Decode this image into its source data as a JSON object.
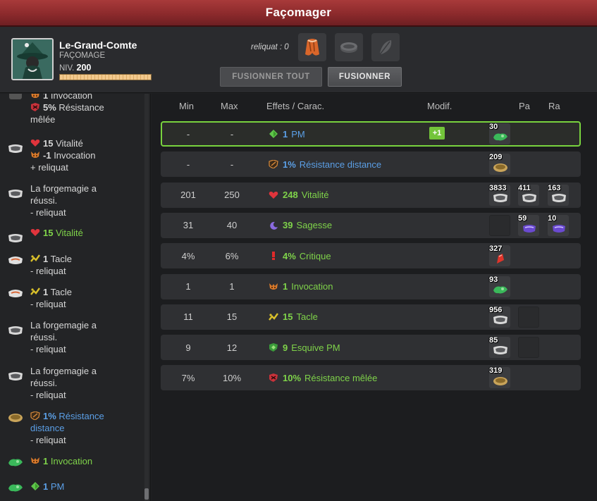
{
  "window": {
    "title": "Façomager"
  },
  "character": {
    "name": "Le-Grand-Comte",
    "job": "FAÇOMAGE",
    "level_label": "NIV.",
    "level": "200",
    "xp_fraction": 1.0
  },
  "fusion": {
    "remainder_label": "reliquat : 0",
    "fuse_all_label": "FUSIONNER TOUT",
    "fuse_label": "FUSIONNER"
  },
  "columns": {
    "min": "Min",
    "max": "Max",
    "effects": "Effets / Carac.",
    "modif": "Modif.",
    "pa": "Pa",
    "ra": "Ra"
  },
  "colors": {
    "accent_green": "#79d33e",
    "stat_green": "#7fd34a",
    "stat_blue": "#5b9fe6",
    "title_red": "#8c2a2c"
  },
  "history": [
    {
      "icon": "crafted-item-icon",
      "lines": [
        {
          "icon": "summon-icon",
          "value": "1",
          "text": "Invocation",
          "cls": ""
        },
        {
          "icon": "melee-resist-icon",
          "value": "5%",
          "text": "Résistance",
          "cls": ""
        },
        {
          "text": "mêlée",
          "cls": ""
        }
      ]
    },
    {
      "icon": "rune-icon",
      "lines": [
        {
          "icon": "heart-icon",
          "value": "15",
          "text": "Vitalité",
          "cls": ""
        },
        {
          "icon": "summon-icon",
          "value": "-1",
          "text": "Invocation",
          "cls": ""
        },
        {
          "text": "+ reliquat",
          "cls": ""
        }
      ]
    },
    {
      "icon": "rune-icon",
      "lines": [
        {
          "text": "La forgemagie a",
          "cls": ""
        },
        {
          "text": "réussi.",
          "cls": ""
        },
        {
          "text": "- reliquat",
          "cls": ""
        }
      ]
    },
    {
      "icon": "rune-icon",
      "lines": [
        {
          "icon": "heart-icon",
          "value": "15",
          "text": "Vitalité",
          "cls": "green"
        }
      ]
    },
    {
      "icon": "tackle-rune-icon",
      "lines": [
        {
          "icon": "tackle-icon",
          "value": "1",
          "text": "Tacle",
          "cls": ""
        },
        {
          "text": "- reliquat",
          "cls": ""
        }
      ]
    },
    {
      "icon": "tackle-rune-icon",
      "lines": [
        {
          "icon": "tackle-icon",
          "value": "1",
          "text": "Tacle",
          "cls": ""
        },
        {
          "text": "- reliquat",
          "cls": ""
        }
      ]
    },
    {
      "icon": "rune-icon",
      "lines": [
        {
          "text": "La forgemagie a",
          "cls": ""
        },
        {
          "text": "réussi.",
          "cls": ""
        },
        {
          "text": "- reliquat",
          "cls": ""
        }
      ]
    },
    {
      "icon": "rune-icon",
      "lines": [
        {
          "text": "La forgemagie a",
          "cls": ""
        },
        {
          "text": "réussi.",
          "cls": ""
        },
        {
          "text": "- reliquat",
          "cls": ""
        }
      ]
    },
    {
      "icon": "gold-rune-icon",
      "lines": [
        {
          "icon": "ranged-resist-icon",
          "value": "1%",
          "text": "Résistance",
          "cls": "blue"
        },
        {
          "text": "distance",
          "cls": "blue"
        },
        {
          "text": "- reliquat",
          "cls": ""
        }
      ]
    },
    {
      "icon": "green-rune-icon",
      "lines": [
        {
          "icon": "summon-icon",
          "value": "1",
          "text": "Invocation",
          "cls": "green"
        }
      ]
    },
    {
      "icon": "green-rune-icon",
      "lines": [
        {
          "icon": "mp-icon",
          "value": "1",
          "text": "PM",
          "cls": "blue"
        }
      ]
    }
  ],
  "rows": [
    {
      "min": "-",
      "max": "-",
      "icon": "mp-icon",
      "value": "1",
      "label": "PM",
      "cls": "blue",
      "modif": "+1",
      "selected": true,
      "runes": [
        {
          "count": "30",
          "gem": "green-rune-icon"
        }
      ]
    },
    {
      "min": "-",
      "max": "-",
      "icon": "ranged-resist-icon",
      "value": "1%",
      "label": "Résistance distance",
      "cls": "blue",
      "runes": [
        {
          "count": "209",
          "gem": "gold-rune-icon"
        }
      ]
    },
    {
      "min": "201",
      "max": "250",
      "icon": "heart-icon",
      "value": "248",
      "label": "Vitalité",
      "cls": "green",
      "runes": [
        {
          "count": "3833",
          "gem": "rune-icon"
        },
        {
          "count": "411",
          "gem": "rune-icon"
        },
        {
          "count": "163",
          "gem": "rune-icon"
        }
      ]
    },
    {
      "min": "31",
      "max": "40",
      "icon": "wisdom-icon",
      "value": "39",
      "label": "Sagesse",
      "cls": "green",
      "runes": [
        {
          "count": "",
          "gem": ""
        },
        {
          "count": "59",
          "gem": "purple-rune-icon"
        },
        {
          "count": "10",
          "gem": "purple-rune-icon"
        }
      ]
    },
    {
      "min": "4%",
      "max": "6%",
      "icon": "critical-icon",
      "value": "4%",
      "label": "Critique",
      "cls": "green",
      "runes": [
        {
          "count": "327",
          "gem": "red-rune-icon"
        }
      ]
    },
    {
      "min": "1",
      "max": "1",
      "icon": "summon-icon",
      "value": "1",
      "label": "Invocation",
      "cls": "green",
      "runes": [
        {
          "count": "93",
          "gem": "green-rune-icon"
        }
      ]
    },
    {
      "min": "11",
      "max": "15",
      "icon": "tackle-icon",
      "value": "15",
      "label": "Tacle",
      "cls": "green",
      "runes": [
        {
          "count": "956",
          "gem": "rune-icon"
        },
        {
          "count": "",
          "gem": ""
        }
      ]
    },
    {
      "min": "9",
      "max": "12",
      "icon": "mp-dodge-icon",
      "value": "9",
      "label": "Esquive PM",
      "cls": "green",
      "runes": [
        {
          "count": "85",
          "gem": "rune-icon"
        },
        {
          "count": "",
          "gem": ""
        }
      ]
    },
    {
      "min": "7%",
      "max": "10%",
      "icon": "melee-resist-icon",
      "value": "10%",
      "label": "Résistance mêlée",
      "cls": "green",
      "runes": [
        {
          "count": "319",
          "gem": "gold-rune-icon"
        }
      ]
    }
  ]
}
